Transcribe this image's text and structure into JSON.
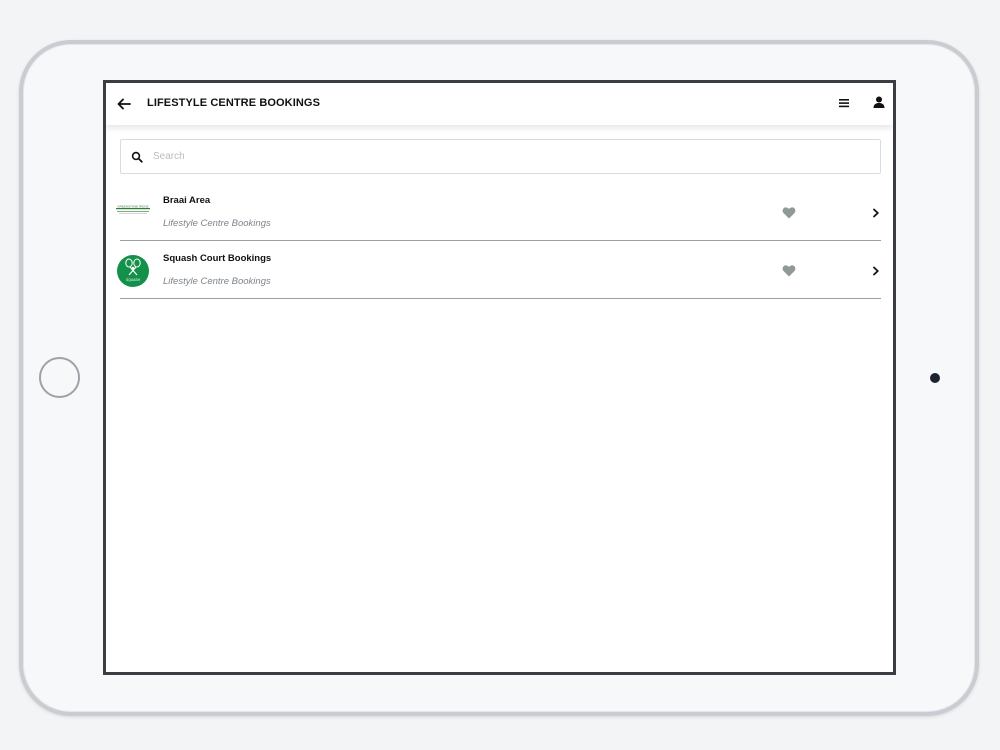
{
  "header": {
    "title": "LIFESTYLE CENTRE BOOKINGS",
    "back_icon": "arrow-left-icon",
    "menu_icon": "hamburger-menu-icon",
    "profile_icon": "user-icon"
  },
  "search": {
    "placeholder": "Search",
    "value": "",
    "icon": "search-icon"
  },
  "items": [
    {
      "title": "Braai Area",
      "subtitle": "Lifestyle Centre Bookings",
      "thumb_text": "GREENSTONE RIDGE",
      "fav_icon": "heart-icon",
      "chevron_icon": "chevron-right-icon"
    },
    {
      "title": "Squash Court Bookings",
      "subtitle": "Lifestyle Centre Bookings",
      "thumb_text": "SQUASH",
      "fav_icon": "heart-icon",
      "chevron_icon": "chevron-right-icon"
    }
  ],
  "colors": {
    "brand_green": "#13914a",
    "heart_gray": "#8f9a98",
    "divider": "#9aa0a6"
  }
}
